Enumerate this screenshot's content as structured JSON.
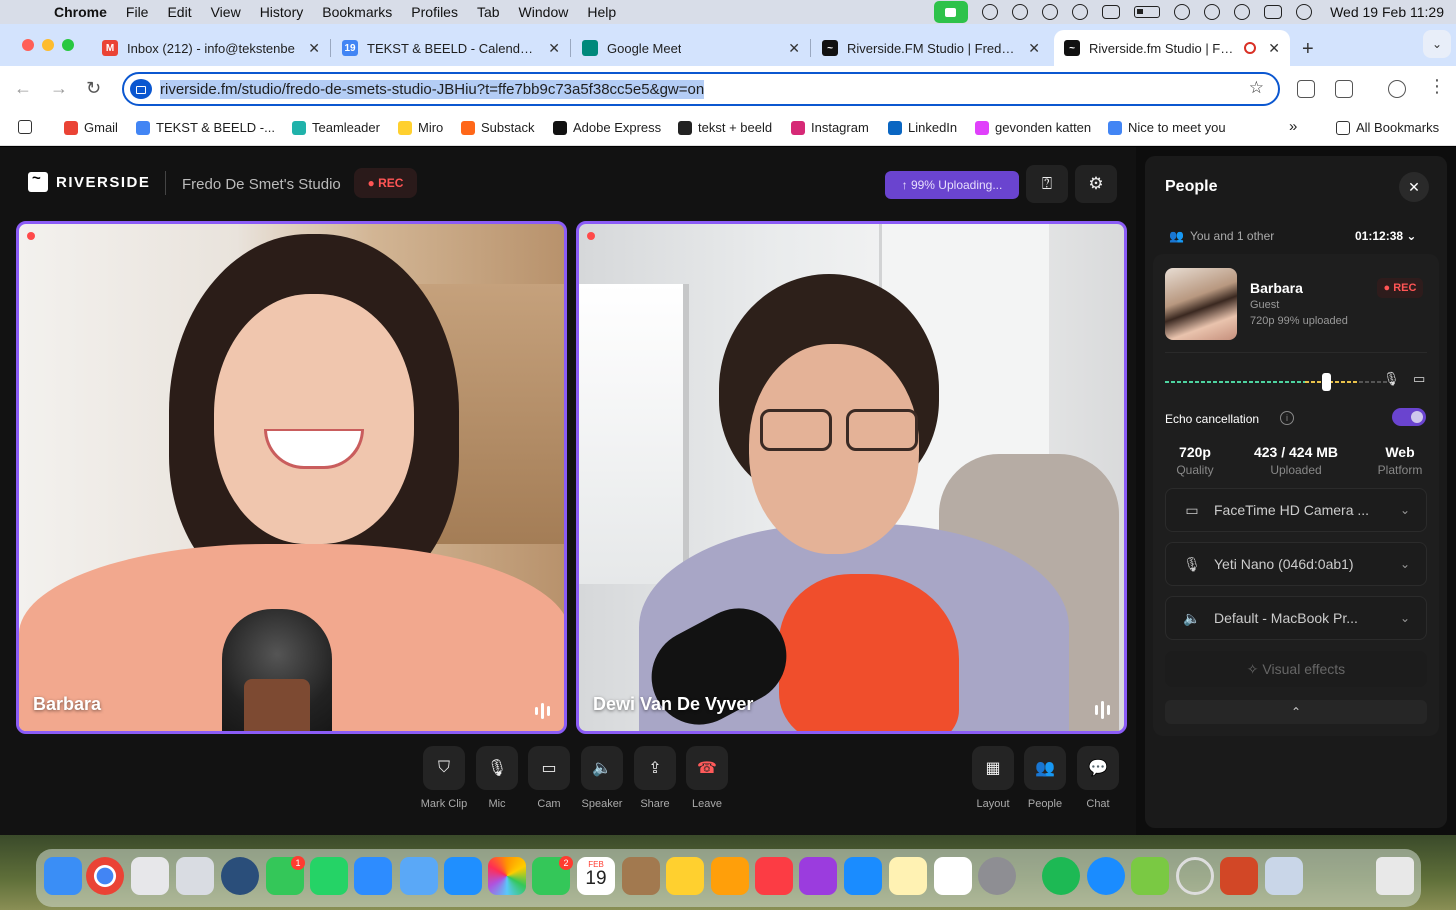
{
  "menubar": {
    "app": "Chrome",
    "items": [
      "File",
      "Edit",
      "View",
      "History",
      "Bookmarks",
      "Profiles",
      "Tab",
      "Window",
      "Help"
    ],
    "clock": "Wed 19 Feb  11:29"
  },
  "tabs": [
    {
      "title": "Inbox (212) - info@tekstenbe",
      "favicon": "gmail-icon",
      "color": "#ea4335"
    },
    {
      "title": "TEKST & BEELD - Calendar -",
      "favicon": "calendar-icon",
      "color": "#4285f4"
    },
    {
      "title": "Google Meet",
      "favicon": "meet-icon",
      "color": "#00897b"
    },
    {
      "title": "Riverside.FM Studio | Fredo D",
      "favicon": "riverside-icon",
      "color": "#111111"
    },
    {
      "title": "Riverside.fm Studio | Fred",
      "favicon": "riverside-icon",
      "color": "#111111"
    }
  ],
  "address_bar": {
    "url": "riverside.fm/studio/fredo-de-smets-studio-JBHiu?t=ffe7bb9c73a5f38cc5e5&gw=on"
  },
  "bookmarks": {
    "items": [
      {
        "label": "Gmail",
        "color": "#ea4335"
      },
      {
        "label": "TEKST & BEELD -...",
        "color": "#4285f4"
      },
      {
        "label": "Teamleader",
        "color": "#20b2aa"
      },
      {
        "label": "Miro",
        "color": "#ffd02f"
      },
      {
        "label": "Substack",
        "color": "#ff6719"
      },
      {
        "label": "Adobe Express",
        "color": "#111111"
      },
      {
        "label": "tekst + beeld",
        "color": "#222222"
      },
      {
        "label": "Instagram",
        "color": "#d62976"
      },
      {
        "label": "LinkedIn",
        "color": "#0a66c2"
      },
      {
        "label": "gevonden katten",
        "color": "#e040fb"
      },
      {
        "label": "Nice to meet you",
        "color": "#4285f4"
      }
    ],
    "overflow": "»",
    "all_label": "All Bookmarks"
  },
  "studio": {
    "logo": "RIVERSIDE",
    "name": "Fredo De Smet's Studio",
    "rec": "● REC",
    "upload": "↑  99% Uploading..."
  },
  "participants": [
    {
      "name": "Barbara"
    },
    {
      "name": "Dewi Van De Vyver"
    }
  ],
  "controls": [
    {
      "label": "Mark Clip",
      "icon": "bookmark-icon",
      "glyph": "⛉"
    },
    {
      "label": "Mic",
      "icon": "mic-icon",
      "glyph": "🎙"
    },
    {
      "label": "Cam",
      "icon": "camera-icon",
      "glyph": "▭"
    },
    {
      "label": "Speaker",
      "icon": "speaker-icon",
      "glyph": "🔈"
    },
    {
      "label": "Share",
      "icon": "share-screen-icon",
      "glyph": "⇪"
    },
    {
      "label": "Leave",
      "icon": "phone-hangup-icon",
      "glyph": "☎"
    }
  ],
  "right_controls": [
    {
      "label": "Layout",
      "icon": "grid-icon",
      "glyph": "▦"
    },
    {
      "label": "People",
      "icon": "people-icon",
      "glyph": "👥"
    },
    {
      "label": "Chat",
      "icon": "chat-icon",
      "glyph": "💬"
    }
  ],
  "panel": {
    "title": "People",
    "count": "You and 1 other",
    "timer": "01:12:38 ⌄",
    "participant": {
      "name": "Barbara",
      "role": "Guest",
      "info": "720p   99% uploaded",
      "rec": "● REC"
    },
    "echo_label": "Echo cancellation",
    "echo_on": true,
    "stats": [
      {
        "value": "720p",
        "label": "Quality"
      },
      {
        "value": "423 / 424 MB",
        "label": "Uploaded"
      },
      {
        "value": "Web",
        "label": "Platform"
      }
    ],
    "devices": [
      {
        "label": "FaceTime HD Camera ...",
        "icon": "camera-icon",
        "glyph": "▭"
      },
      {
        "label": "Yeti Nano (046d:0ab1)",
        "icon": "mic-icon",
        "glyph": "🎙"
      },
      {
        "label": "Default - MacBook Pr...",
        "icon": "speaker-icon",
        "glyph": "🔈"
      }
    ],
    "visual_effects": "Visual effects",
    "collapse": "⌃"
  },
  "dock": {
    "badges": {
      "messages": "1",
      "facetime": "2"
    },
    "calendar_month": "FEB",
    "calendar_day": "19"
  }
}
